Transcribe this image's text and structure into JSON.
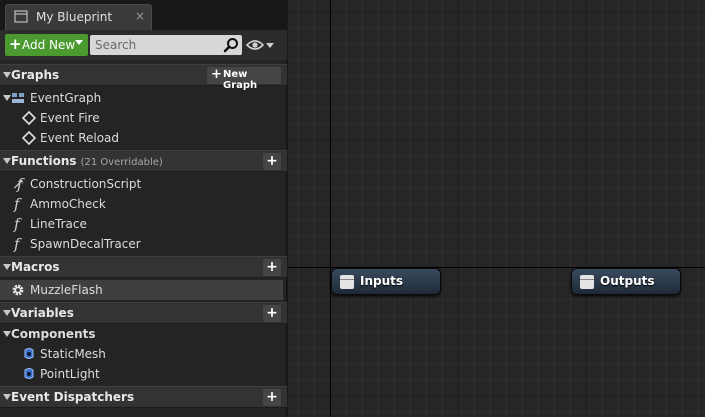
{
  "tab": {
    "title": "My Blueprint",
    "close": "×"
  },
  "toolbar": {
    "add_new_label": "Add New",
    "search_placeholder": "Search"
  },
  "sections": {
    "graphs": {
      "title": "Graphs",
      "button": "New Graph",
      "items": [
        "EventGraph",
        "Event Fire",
        "Event Reload"
      ]
    },
    "functions": {
      "title": "Functions",
      "subtitle": "(21 Overridable)",
      "items": [
        "ConstructionScript",
        "AmmoCheck",
        "LineTrace",
        "SpawnDecalTracer"
      ]
    },
    "macros": {
      "title": "Macros",
      "items": [
        "MuzzleFlash"
      ]
    },
    "variables": {
      "title": "Variables"
    },
    "components": {
      "title": "Components",
      "items": [
        "StaticMesh",
        "PointLight"
      ]
    },
    "dispatchers": {
      "title": "Event Dispatchers"
    }
  },
  "graph": {
    "nodes": [
      {
        "label": "Inputs"
      },
      {
        "label": "Outputs"
      }
    ]
  },
  "colors": {
    "accent_green": "#4a9a2f",
    "node_blue": "#2c3a4c",
    "panel": "#242424"
  },
  "icons": [
    "blueprint-icon",
    "plus-icon",
    "chevron-down-icon",
    "magnifier-icon",
    "eye-icon",
    "graph-icon",
    "event-icon",
    "function-icon",
    "gear-icon",
    "component-icon"
  ]
}
